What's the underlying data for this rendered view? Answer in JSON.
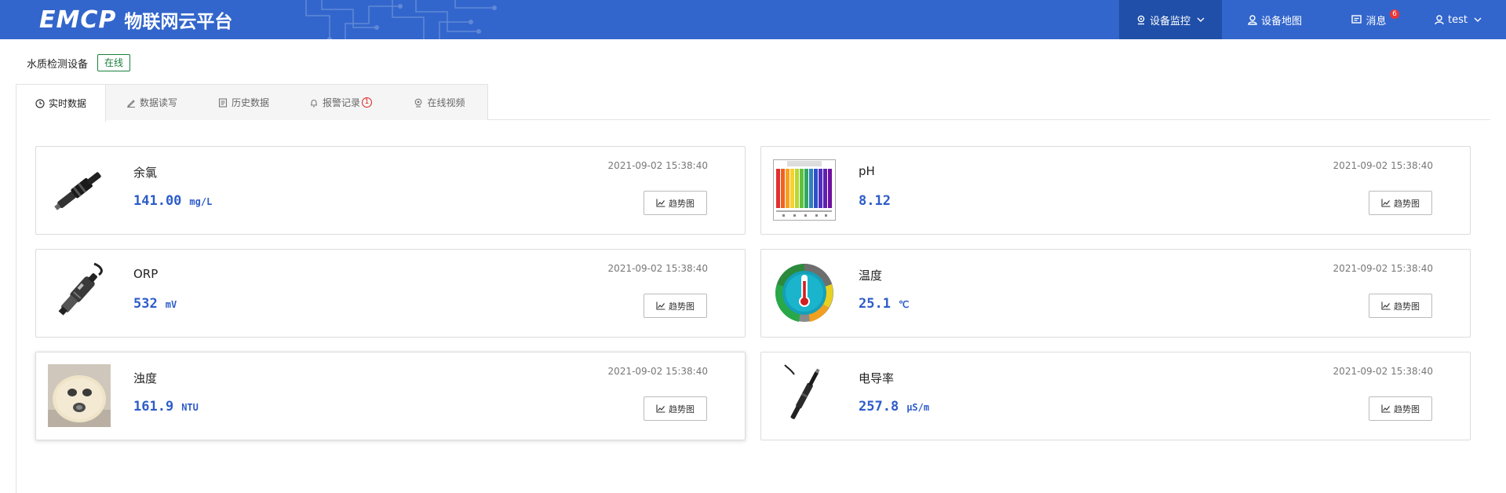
{
  "header": {
    "logo_text": "EMCP",
    "platform_name": "物联网云平台",
    "nav": [
      {
        "label": "设备监控",
        "icon": "location-pin-icon",
        "active": true,
        "dropdown": true
      },
      {
        "label": "设备地图",
        "icon": "map-user-icon",
        "active": false,
        "dropdown": false
      },
      {
        "label": "消息",
        "icon": "message-icon",
        "active": false,
        "badge": "6"
      },
      {
        "label": "test",
        "icon": "user-icon",
        "active": false,
        "dropdown": true
      }
    ]
  },
  "device": {
    "name": "水质检测设备",
    "status": "在线",
    "status_color": "#1a7f3c"
  },
  "tabs": [
    {
      "label": "实时数据",
      "icon": "clock-icon",
      "active": true
    },
    {
      "label": "数据读写",
      "icon": "pen-icon",
      "active": false
    },
    {
      "label": "历史数据",
      "icon": "document-icon",
      "active": false
    },
    {
      "label": "报警记录",
      "icon": "bell-icon",
      "active": false,
      "count": "1"
    },
    {
      "label": "在线视频",
      "icon": "camera-icon",
      "active": false
    }
  ],
  "sensors": [
    {
      "name": "余氯",
      "value": "141.00",
      "unit": "mg/L",
      "timestamp": "2021-09-02 15:38:40",
      "button": "趋势图",
      "image": "chlorine-probe"
    },
    {
      "name": "pH",
      "value": "8.12",
      "unit": "",
      "timestamp": "2021-09-02 15:38:40",
      "button": "趋势图",
      "image": "ph-color-chart"
    },
    {
      "name": "ORP",
      "value": "532",
      "unit": "mV",
      "timestamp": "2021-09-02 15:38:40",
      "button": "趋势图",
      "image": "orp-probe"
    },
    {
      "name": "温度",
      "value": "25.1",
      "unit": "℃",
      "timestamp": "2021-09-02 15:38:40",
      "button": "趋势图",
      "image": "thermometer"
    },
    {
      "name": "浊度",
      "value": "161.9",
      "unit": "NTU",
      "timestamp": "2021-09-02 15:38:40",
      "button": "趋势图",
      "image": "turbidity-probe"
    },
    {
      "name": "电导率",
      "value": "257.8",
      "unit": "μS/m",
      "timestamp": "2021-09-02 15:38:40",
      "button": "趋势图",
      "image": "conductivity-probe"
    }
  ],
  "colors": {
    "header_bg": "#3366cc",
    "nav_active": "#1f4fa8",
    "value_blue": "#2d5cc8",
    "badge_red": "#e33333"
  }
}
